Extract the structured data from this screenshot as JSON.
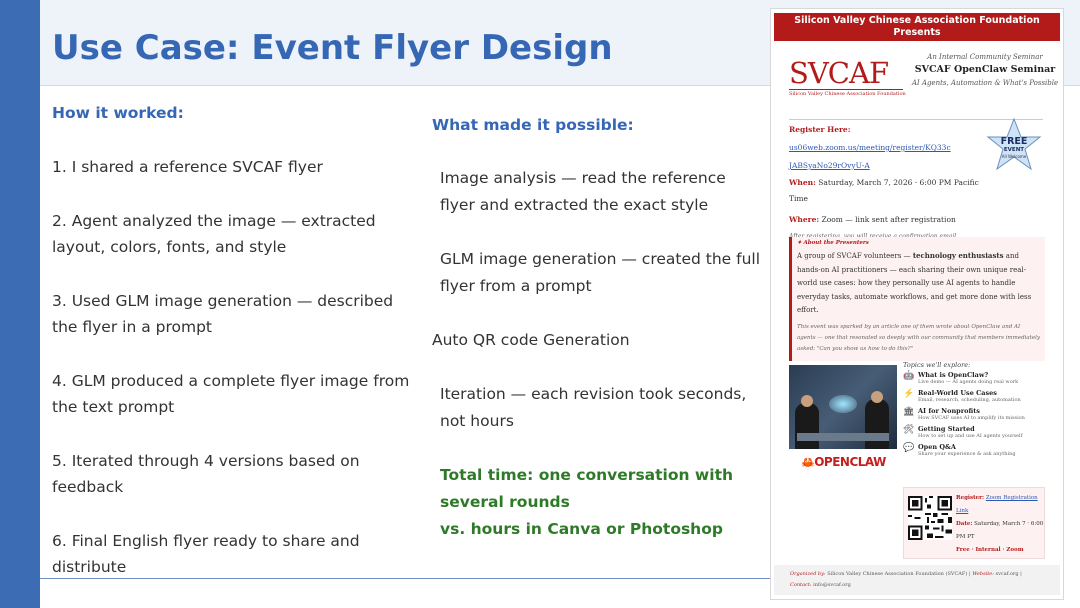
{
  "slide": {
    "title": "Use Case: Event Flyer Design"
  },
  "left": {
    "heading": "How it worked:",
    "steps": [
      "1.  I shared a reference SVCAF flyer",
      "2.  Agent analyzed the image — extracted layout, colors, fonts, and style",
      "3.  Used GLM image generation — described the flyer in a prompt",
      "4.  GLM produced a complete flyer image from the text prompt",
      "5.  Iterated through 4 versions based on feedback",
      "6.  Final English flyer ready to share and distribute"
    ]
  },
  "middle": {
    "heading": "What made it possible:",
    "items": [
      "Image analysis — read the reference flyer and extracted the exact style",
      "GLM image generation — created the full flyer from a prompt",
      "Auto QR code Generation",
      "Iteration — each revision took seconds, not hours"
    ],
    "total_line1": "Total time: one conversation with several rounds",
    "total_line2": "vs. hours in Canva or Photoshop"
  },
  "flyer": {
    "top_banner_1": "Silicon Valley Chinese Association Foundation",
    "top_banner_2": "Presents",
    "logo": "SVCAF",
    "logo_sub": "Silicon Valley Chinese Association Foundation",
    "seminar_kicker": "An Internal Community Seminar",
    "seminar_title": "SVCAF OpenClaw Seminar",
    "seminar_subtitle": "AI Agents, Automation & What's Possible",
    "register_label": "Register Here:",
    "register_link_1": "us06web.zoom.us/meeting/register/KQ33c",
    "register_link_2": "JABSyaNo29rOvyU-A",
    "when_label": "When:",
    "when_value": "Saturday, March 7, 2026  ·  6:00 PM Pacific Time",
    "where_label": "Where:",
    "where_value": "Zoom — link sent after registration",
    "confirm_note": "After registering, you will receive a confirmation email containing information about joining the meeting.",
    "star_free": "FREE",
    "star_event": "EVENT",
    "star_welcome": "All Welcome",
    "presenters_heading": "✦ About the Presenters",
    "presenters_pre": "A group of SVCAF volunteers — ",
    "presenters_bold": "technology enthusiasts",
    "presenters_post": " and hands-on AI practitioners — each sharing their own unique real-world use cases: how they personally use AI agents to handle everyday tasks, automate workflows, and get more done with less effort.",
    "presenters_italic": "This event was sparked by an article one of them wrote about OpenClaw and AI agents — one that resonated so deeply with our community that members immediately asked: \"Can you show us how to do this?\"",
    "topics_heading": "Topics we'll explore:",
    "topics": [
      {
        "icon": "🤖",
        "title": "What is OpenClaw?",
        "desc": "Live demo — AI agents doing real work"
      },
      {
        "icon": "⚡",
        "title": "Real-World Use Cases",
        "desc": "Email, research, scheduling, automation"
      },
      {
        "icon": "🏛",
        "title": "AI for Nonprofits",
        "desc": "How SVCAF uses AI to amplify its mission"
      },
      {
        "icon": "🛠",
        "title": "Getting Started",
        "desc": "How to set up and use AI agents yourself"
      },
      {
        "icon": "💬",
        "title": "Open Q&A",
        "desc": "Share your experience & ask anything"
      }
    ],
    "openclaw_logo": "OPENCLAW",
    "reg_label": "Register:",
    "reg_link_1": "Zoom Registration",
    "reg_link_2": "Link",
    "date_label": "Date:",
    "date_value": "Saturday, March 7 · 6:00 PM PT",
    "reg_tags": "Free · Internal · Zoom",
    "footer_org_label": "Organized by:",
    "footer_org_value": "Silicon Valley Chinese Association Foundation (SVCAF)",
    "footer_web_label": "Website:",
    "footer_web_value": "svcaf.org",
    "footer_contact_label": "Contact:",
    "footer_contact_value": "info@svcaf.org"
  },
  "colors": {
    "accent_blue": "#3567b5",
    "sidebar_blue": "#3b6cb4",
    "success_green": "#2e7a28",
    "flyer_red": "#b31b1b"
  }
}
